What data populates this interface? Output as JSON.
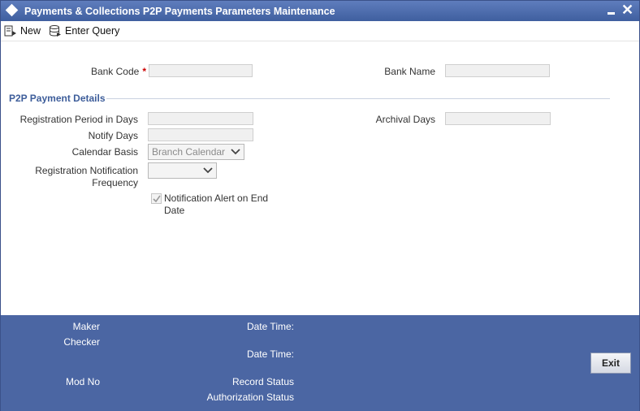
{
  "window": {
    "title": "Payments & Collections P2P Payments Parameters Maintenance",
    "minimize_icon": "minimize-icon",
    "close_glyph": "✕"
  },
  "toolbar": {
    "new_label": "New",
    "new_icon": "new-document-icon",
    "enter_query_label": "Enter Query",
    "enter_query_icon": "database-query-icon"
  },
  "header_fields": {
    "bank_code_label": "Bank Code",
    "bank_code_required": "*",
    "bank_code_value": "",
    "bank_name_label": "Bank Name",
    "bank_name_value": ""
  },
  "p2p_section": {
    "title": "P2P Payment Details",
    "registration_period_label": "Registration Period in Days",
    "registration_period_value": "",
    "archival_days_label": "Archival Days",
    "archival_days_value": "",
    "notify_days_label": "Notify Days",
    "notify_days_value": "",
    "calendar_basis_label": "Calendar Basis",
    "calendar_basis_value": "Branch Calendar",
    "reg_notification_label_line1": "Registration Notification",
    "reg_notification_label_line2": "Frequency",
    "reg_notification_value": "",
    "notification_alert_label": "Notification Alert on End Date",
    "notification_alert_checked": true
  },
  "footer": {
    "maker_label": "Maker",
    "checker_label": "Checker",
    "date_time_label_1": "Date Time:",
    "date_time_label_2": "Date Time:",
    "mod_no_label": "Mod No",
    "record_status_label": "Record Status",
    "authorization_status_label": "Authorization Status",
    "exit_label": "Exit"
  },
  "colors": {
    "title_bar": "#4b66a3",
    "section_title": "#3d5d9a",
    "required": "#cc0000"
  }
}
